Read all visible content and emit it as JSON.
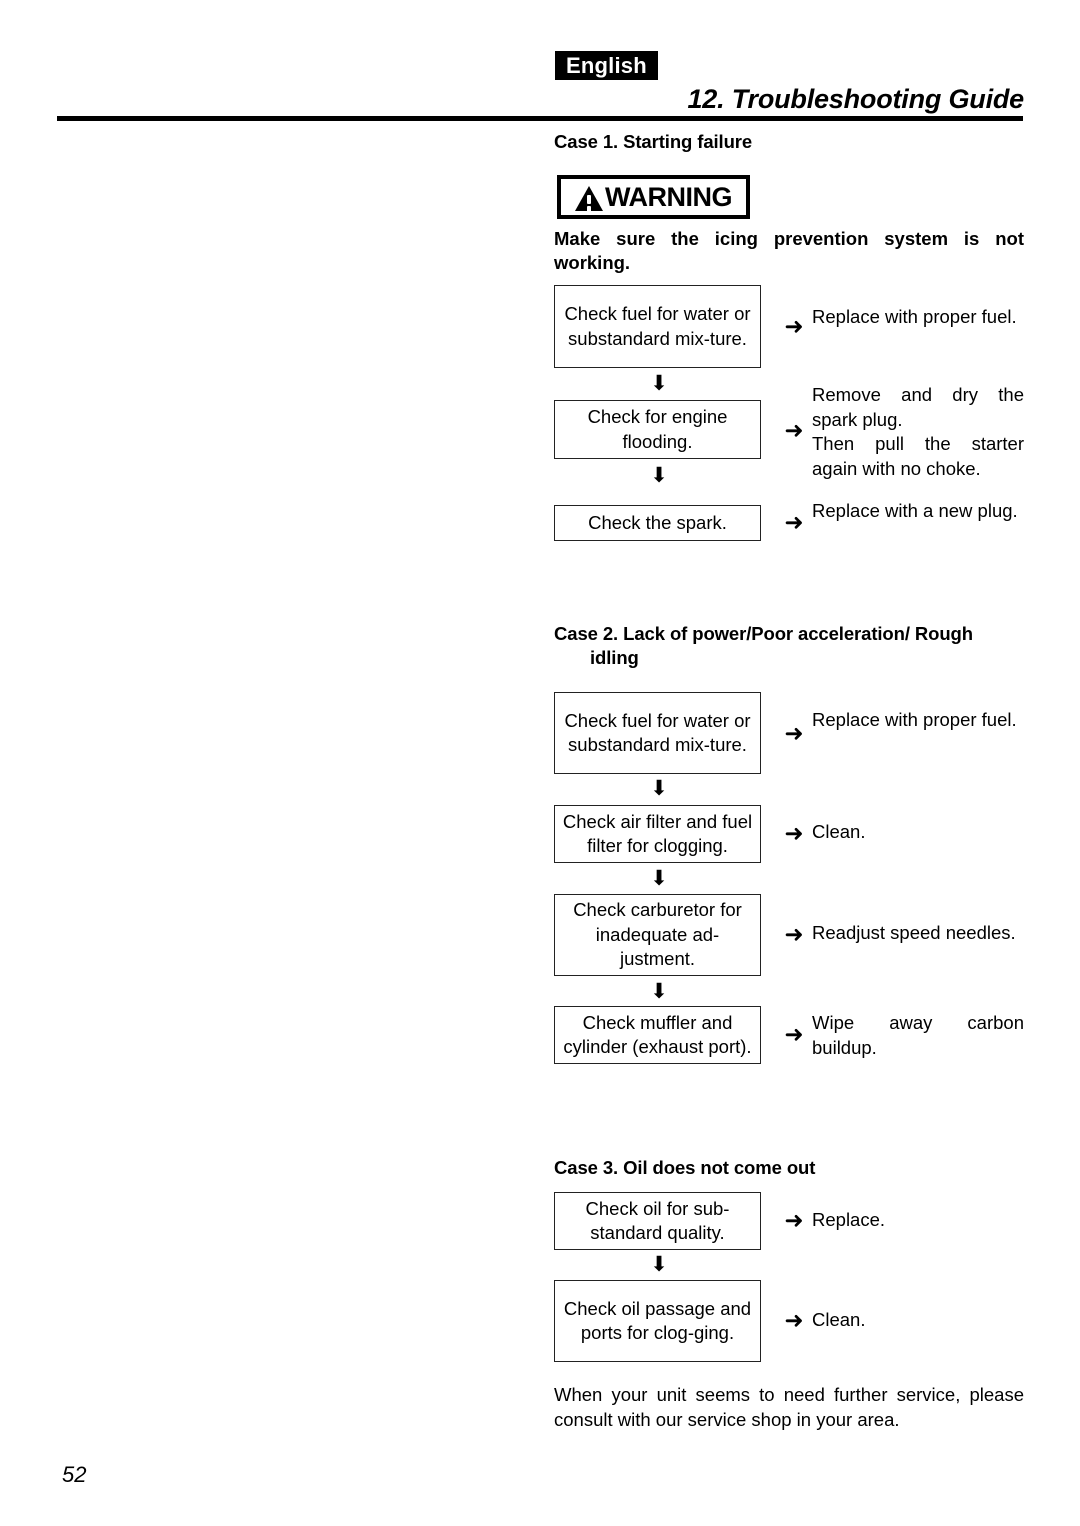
{
  "header": {
    "language_tag": "English",
    "title": "12. Troubleshooting Guide"
  },
  "page_number": "52",
  "warning": {
    "label": "WARNING",
    "icon": "warning-triangle-icon",
    "body": "Make sure the icing prevention system is not working."
  },
  "arrows": {
    "down": "⬇",
    "right": "➜"
  },
  "cases": [
    {
      "heading": "Case 1. Starting failure",
      "heading_cont": "",
      "steps": [
        {
          "check": "Check fuel for water or substandard mix-ture.",
          "action": "Replace with proper fuel."
        },
        {
          "check": "Check for engine flooding.",
          "action": "Remove and dry the spark plug.\nThen pull the starter again with no choke."
        },
        {
          "check": "Check the spark.",
          "action": "Replace with a new plug."
        }
      ]
    },
    {
      "heading": "Case 2. Lack of power/Poor acceleration/ Rough",
      "heading_cont": "idling",
      "steps": [
        {
          "check": "Check fuel for water or substandard mix-ture.",
          "action": "Replace with proper fuel."
        },
        {
          "check": "Check air filter and fuel filter for clogging.",
          "action": "Clean."
        },
        {
          "check": "Check carburetor for inadequate ad-justment.",
          "action": "Readjust speed needles."
        },
        {
          "check": "Check muffler and cylinder (exhaust port).",
          "action": "Wipe away carbon buildup."
        }
      ]
    },
    {
      "heading": "Case 3. Oil does not come out",
      "heading_cont": "",
      "steps": [
        {
          "check": "Check oil for sub-standard quality.",
          "action": "Replace."
        },
        {
          "check": "Check oil passage and ports for clog-ging.",
          "action": "Clean."
        }
      ]
    }
  ],
  "closing_note": "When your unit seems to need further service, please consult with our service shop in your area."
}
